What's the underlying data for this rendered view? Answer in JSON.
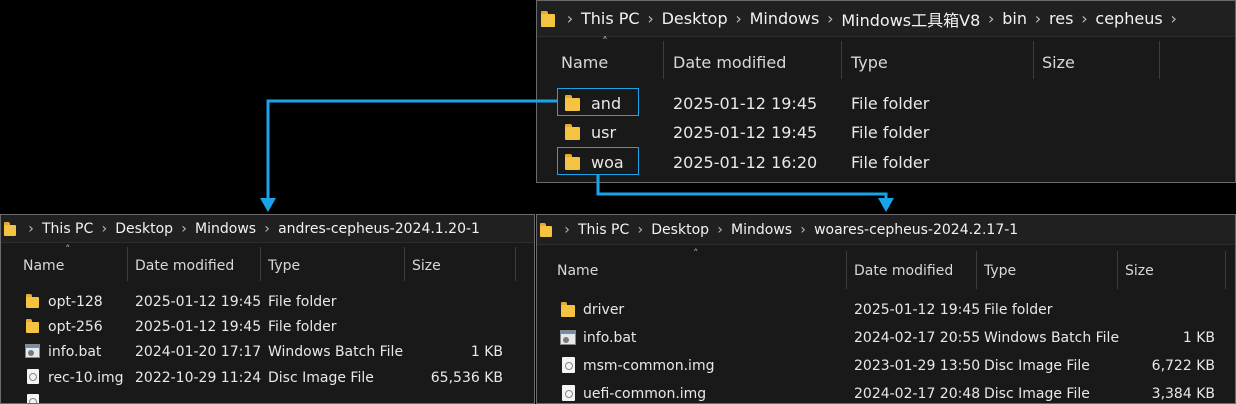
{
  "top_window": {
    "breadcrumb": [
      "This PC",
      "Desktop",
      "Mindows",
      "Mindows工具箱V8",
      "bin",
      "res",
      "cepheus"
    ],
    "columns": {
      "name": "Name",
      "date": "Date modified",
      "type": "Type",
      "size": "Size"
    },
    "rows": [
      {
        "name": "and",
        "date": "2025-01-12 19:45",
        "type": "File folder",
        "size": "",
        "icon": "folder-icon"
      },
      {
        "name": "usr",
        "date": "2025-01-12 19:45",
        "type": "File folder",
        "size": "",
        "icon": "folder-icon"
      },
      {
        "name": "woa",
        "date": "2025-01-12 16:20",
        "type": "File folder",
        "size": "",
        "icon": "folder-icon"
      }
    ]
  },
  "left_window": {
    "breadcrumb": [
      "This PC",
      "Desktop",
      "Mindows",
      "andres-cepheus-2024.1.20-1"
    ],
    "columns": {
      "name": "Name",
      "date": "Date modified",
      "type": "Type",
      "size": "Size"
    },
    "rows": [
      {
        "name": "opt-128",
        "date": "2025-01-12 19:45",
        "type": "File folder",
        "size": "",
        "icon": "folder-icon"
      },
      {
        "name": "opt-256",
        "date": "2025-01-12 19:45",
        "type": "File folder",
        "size": "",
        "icon": "folder-icon"
      },
      {
        "name": "info.bat",
        "date": "2024-01-20 17:17",
        "type": "Windows Batch File",
        "size": "1 KB",
        "icon": "batch-file-icon"
      },
      {
        "name": "rec-10.img",
        "date": "2022-10-29 11:24",
        "type": "Disc Image File",
        "size": "65,536 KB",
        "icon": "disc-image-icon"
      }
    ]
  },
  "right_window": {
    "breadcrumb": [
      "This PC",
      "Desktop",
      "Mindows",
      "woares-cepheus-2024.2.17-1"
    ],
    "columns": {
      "name": "Name",
      "date": "Date modified",
      "type": "Type",
      "size": "Size"
    },
    "rows": [
      {
        "name": "driver",
        "date": "2025-01-12 19:45",
        "type": "File folder",
        "size": "",
        "icon": "folder-icon"
      },
      {
        "name": "info.bat",
        "date": "2024-02-17 20:55",
        "type": "Windows Batch File",
        "size": "1 KB",
        "icon": "batch-file-icon"
      },
      {
        "name": "msm-common.img",
        "date": "2023-01-29 13:50",
        "type": "Disc Image File",
        "size": "6,722 KB",
        "icon": "disc-image-icon"
      },
      {
        "name": "uefi-common.img",
        "date": "2024-02-17 20:48",
        "type": "Disc Image File",
        "size": "3,384 KB",
        "icon": "disc-image-icon"
      }
    ]
  },
  "colors": {
    "highlight": "#1aa3e8",
    "arrow": "#1aa3e8",
    "background": "#000000",
    "window": "#191919"
  }
}
